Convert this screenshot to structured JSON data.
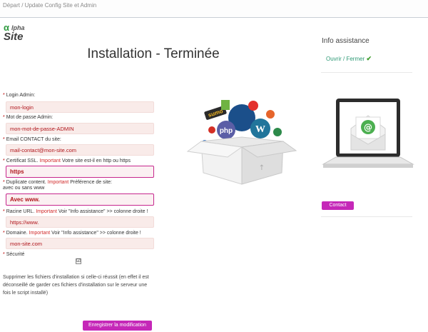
{
  "breadcrumb": "Départ / Update Config Site et Admin",
  "logo": {
    "alpha": "α",
    "lpha": "lpha",
    "site": "Site"
  },
  "title": "Installation - Terminée",
  "form": {
    "login": {
      "label": "Login Admin:",
      "value": "mon-login"
    },
    "password": {
      "label": "Mot de passe Admin:",
      "value": "mon-mot-de-passe-ADMIN"
    },
    "email": {
      "label": "Email CONTACT du site:",
      "value": "mail-contact@mon-site.com"
    },
    "ssl": {
      "label_prefix": "Certificat SSL.",
      "important": "Important",
      "label_suffix": "Votre site est-il en http ou https",
      "value": "https"
    },
    "duplicate": {
      "label_prefix": "Duplicate content.",
      "important": "Important",
      "label_suffix": "Préférence de site:",
      "label_line2": "avec ou sans www",
      "value": "Avec www."
    },
    "root_url": {
      "label_prefix": "Racine URL.",
      "important": "Important",
      "label_suffix": "Voir \"Info assistance\" >> colonne droite !",
      "value": "https://www."
    },
    "domain": {
      "label_prefix": "Domaine.",
      "important": "Important",
      "label_suffix": "Voir \"Info assistance\" >> colonne droite !",
      "value": "mon-site.com"
    },
    "security": {
      "label": "Sécurité",
      "checked": true,
      "check_glyph": "☑"
    },
    "note": "Supprimer les fichiers d'installation si celle-ci réussit (en effet il est déconseillé de garder ces fichiers d'installation sur le serveur une fois le script installé)",
    "save_label": "Enregistrer la modification",
    "required_mark": "*"
  },
  "sidebar": {
    "title": "Info assistance",
    "toggle_label": "Ouvrir / Fermer",
    "toggle_tick": "✔",
    "contact_label": "Contact"
  },
  "illustration": {
    "laptop_symbol": "@",
    "logos": [
      "sumo",
      "php",
      "WordPress",
      "Drupal",
      "Joomla",
      "Zend"
    ],
    "box_mark": "↑"
  },
  "colors": {
    "accent": "#c528b8",
    "field_bg": "#f9ebe9",
    "field_text": "#b0141a",
    "toggle_text": "#2f9a76",
    "logo_green": "#2e9a3f"
  }
}
